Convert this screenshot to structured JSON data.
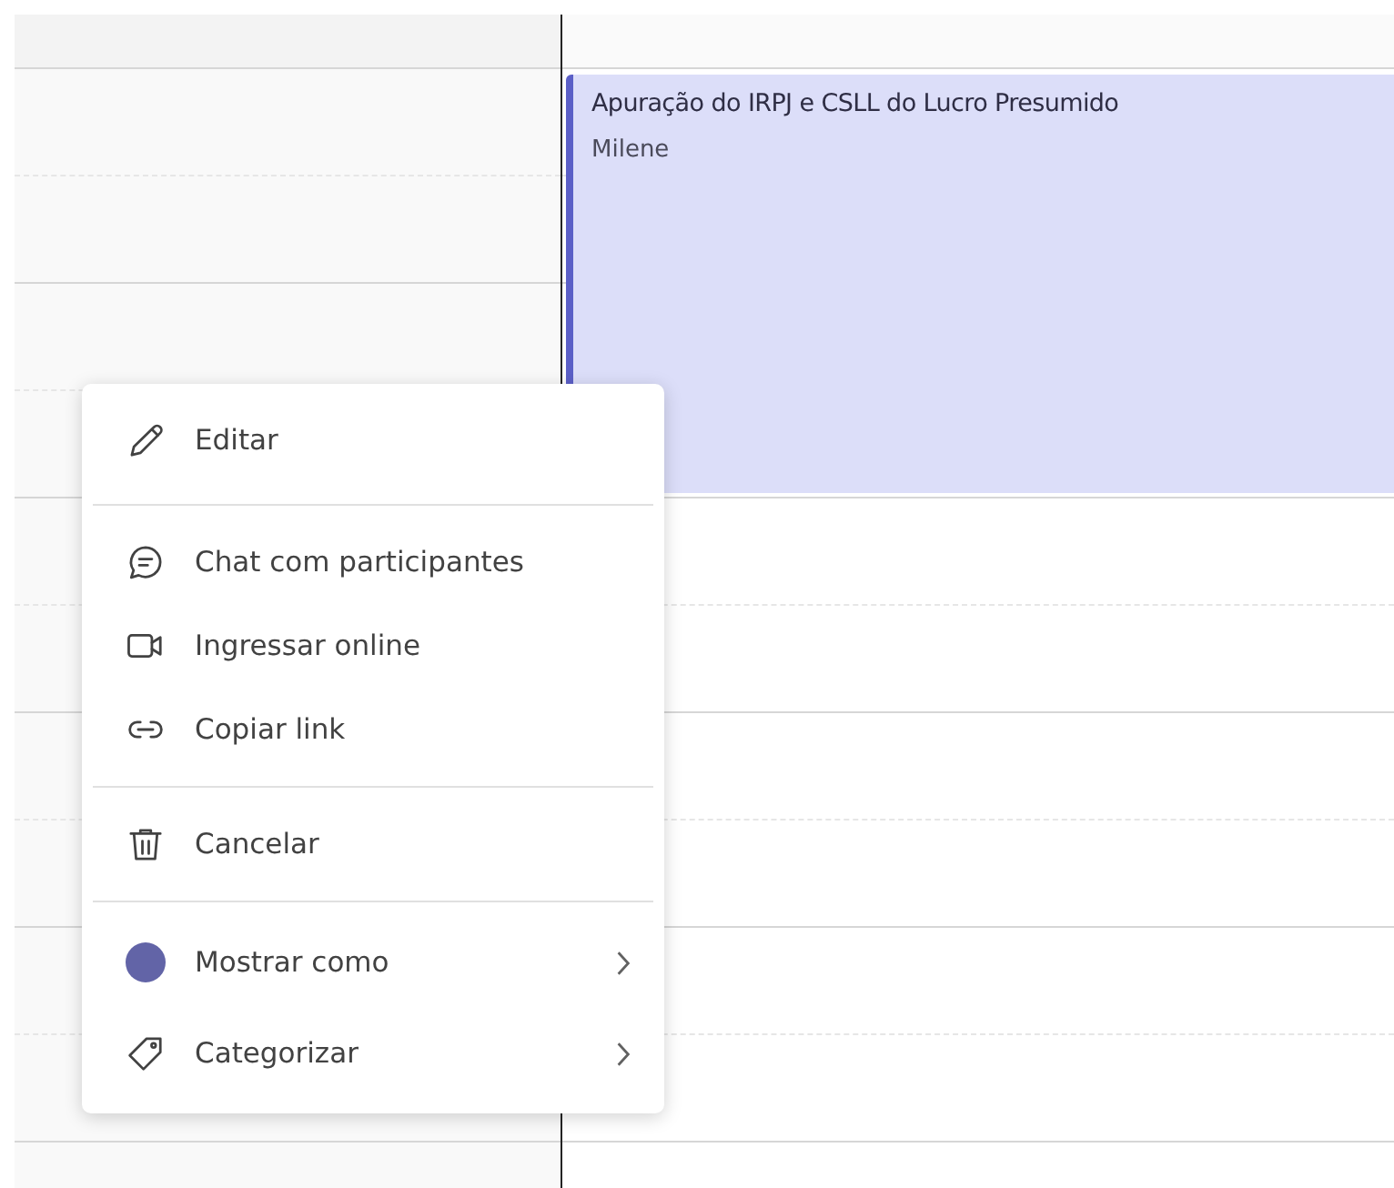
{
  "event": {
    "title": "Apuração do IRPJ e CSLL do Lucro Presumido",
    "organizer": "Milene"
  },
  "context_menu": {
    "groups": [
      [
        {
          "label": "Editar",
          "submenu": false
        }
      ],
      [
        {
          "label": "Chat com participantes",
          "submenu": false
        },
        {
          "label": "Ingressar online",
          "submenu": false
        },
        {
          "label": "Copiar link",
          "submenu": false
        }
      ],
      [
        {
          "label": "Cancelar",
          "submenu": false
        }
      ],
      [
        {
          "label": "Mostrar como",
          "submenu": true,
          "color": "#6264a7"
        },
        {
          "label": "Categorizar",
          "submenu": true
        }
      ]
    ]
  }
}
